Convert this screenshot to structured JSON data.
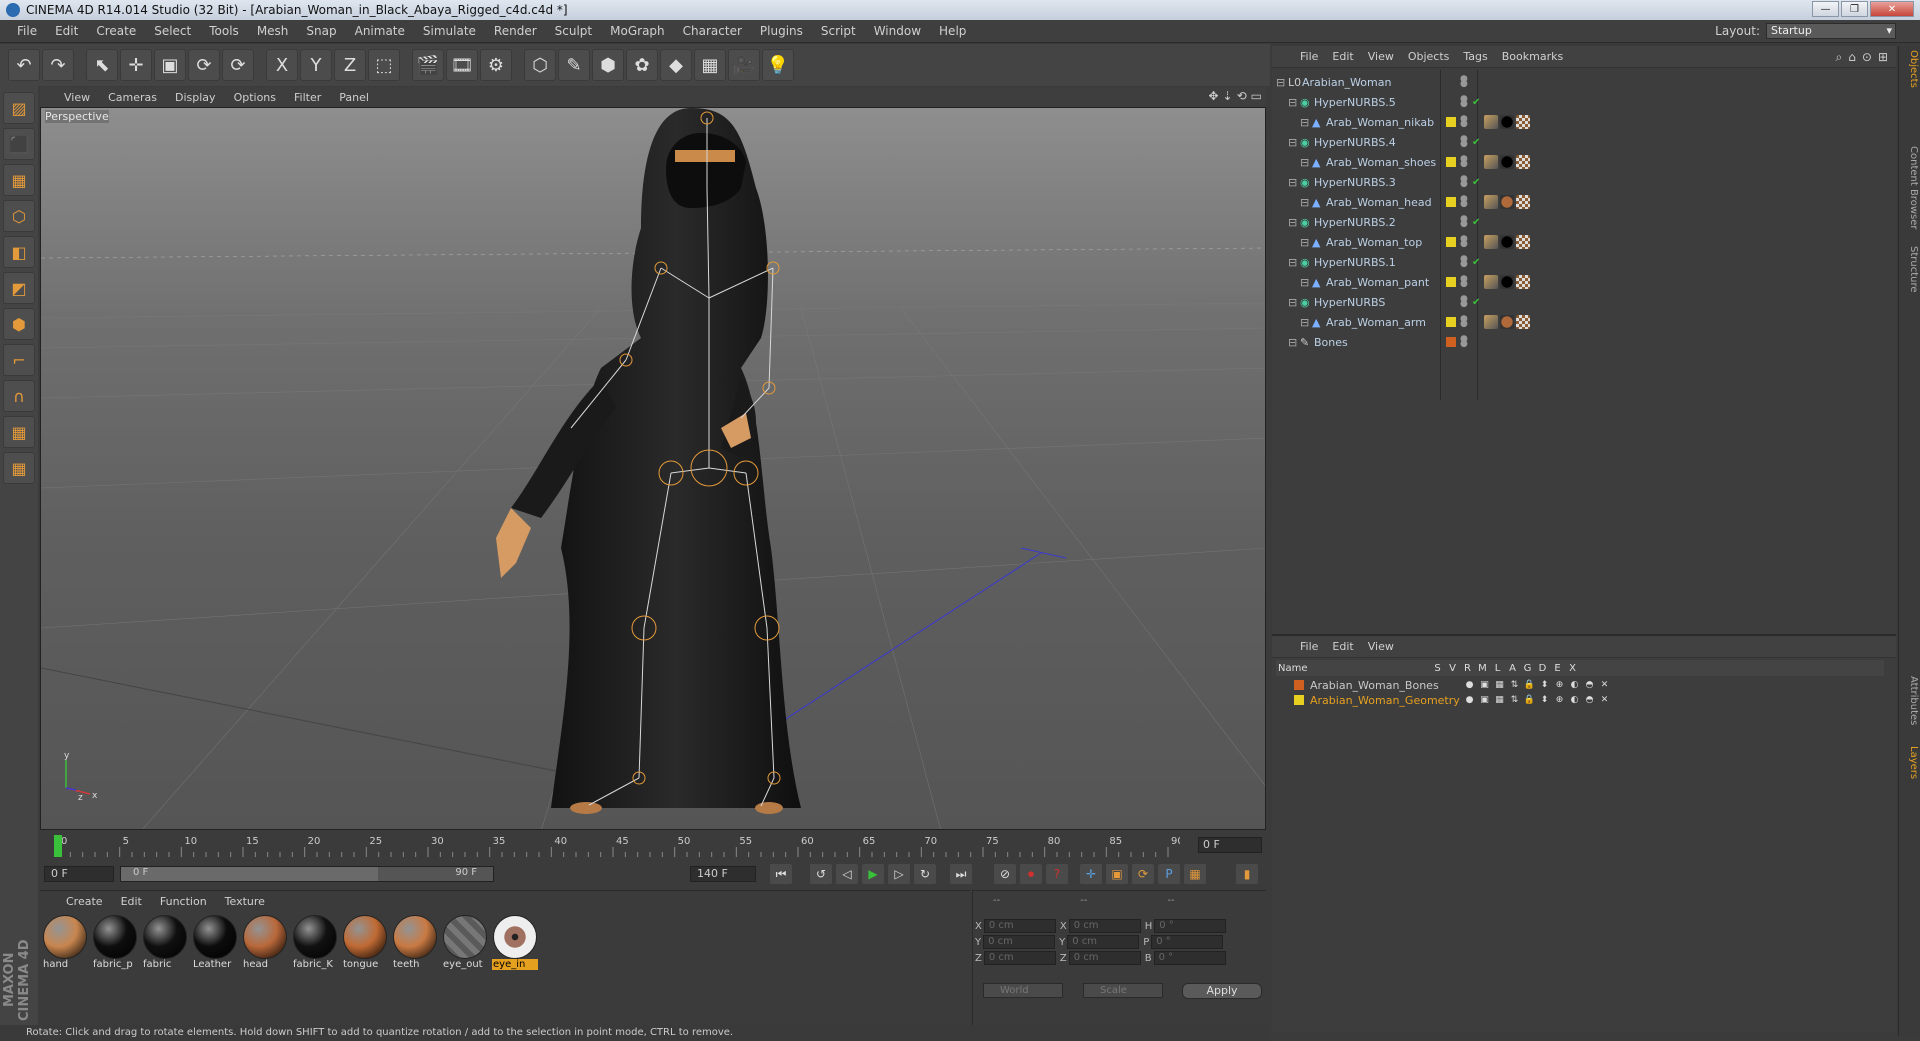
{
  "window": {
    "title": "CINEMA 4D R14.014 Studio (32 Bit) - [Arabian_Woman_in_Black_Abaya_Rigged_c4d.c4d *]",
    "buttons": [
      "—",
      "❐",
      "✕"
    ]
  },
  "menubar": [
    "File",
    "Edit",
    "Create",
    "Select",
    "Tools",
    "Mesh",
    "Snap",
    "Animate",
    "Simulate",
    "Render",
    "Sculpt",
    "MoGraph",
    "Character",
    "Plugins",
    "Script",
    "Window",
    "Help"
  ],
  "layout": {
    "label": "Layout:",
    "value": "Startup"
  },
  "toolbar": {
    "icons": [
      "undo-icon",
      "redo-icon",
      "live-selection-icon",
      "move-icon",
      "scale-icon",
      "rotate-icon",
      "recent-tool-icon",
      "x-axis-icon",
      "y-axis-icon",
      "z-axis-icon",
      "coordinate-system-icon",
      "render-view-icon",
      "render-picture-viewer-icon",
      "render-settings-icon",
      "cube-icon",
      "spline-pen-icon",
      "subdivision-surface-icon",
      "cloner-icon",
      "deformer-icon",
      "floor-icon",
      "camera-icon",
      "light-icon"
    ],
    "glyphs": [
      "↶",
      "↷",
      "⬉",
      "✛",
      "▣",
      "⟳",
      "⟳",
      "X",
      "Y",
      "Z",
      "⬚",
      "🎬",
      "🎞",
      "⚙",
      "⬡",
      "✎",
      "⬢",
      "✿",
      "◆",
      "▦",
      "🎥",
      "💡"
    ]
  },
  "lefttools": {
    "glyphs": [
      "▨",
      "⬛",
      "▦",
      "⬡",
      "◧",
      "◩",
      "⬢",
      "⌐",
      "∩",
      "▦",
      "▦"
    ]
  },
  "brand": "MAXON CINEMA 4D",
  "viewport_menu": [
    "View",
    "Cameras",
    "Display",
    "Options",
    "Filter",
    "Panel"
  ],
  "viewport_nav": [
    "✥",
    "⇣",
    "⟲",
    "▭"
  ],
  "viewport_label": "Perspective",
  "axis_labels": {
    "x": "x",
    "y": "y",
    "z": "z"
  },
  "timeline": {
    "ticks": [
      0,
      5,
      10,
      15,
      20,
      25,
      30,
      35,
      40,
      45,
      50,
      55,
      60,
      65,
      70,
      75,
      80,
      85,
      90
    ],
    "max_frame": 90,
    "current_frame": "0 F",
    "current_position": 0
  },
  "transport": {
    "start_field": "0 F",
    "range_start": "0 F",
    "range_end": "90 F",
    "end_field": "140 F",
    "range_fraction": 0.69
  },
  "materials": {
    "menu": [
      "Create",
      "Edit",
      "Function",
      "Texture"
    ],
    "items": [
      {
        "name": "hand",
        "color": "#c8864f",
        "selected": false
      },
      {
        "name": "fabric_p",
        "color": "#0e0e0e",
        "selected": false
      },
      {
        "name": "fabric",
        "color": "#101010",
        "selected": false
      },
      {
        "name": "Leather",
        "color": "#0c0c0c",
        "selected": false
      },
      {
        "name": "head",
        "color": "#b9683a",
        "selected": false
      },
      {
        "name": "fabric_K",
        "color": "#111111",
        "selected": false
      },
      {
        "name": "tongue",
        "color": "#c06a34",
        "selected": false
      },
      {
        "name": "teeth",
        "color": "#c97a43",
        "selected": false
      },
      {
        "name": "eye_out",
        "color": "#6a6a6a",
        "selected": false
      },
      {
        "name": "eye_in",
        "color": "#8a5a4a",
        "selected": true
      }
    ]
  },
  "coordinates": {
    "headers": [
      "--",
      "--",
      "--"
    ],
    "rows": [
      {
        "a": "X",
        "av": "0 cm",
        "b": "X",
        "bv": "0 cm",
        "c": "H",
        "cv": "0 °"
      },
      {
        "a": "Y",
        "av": "0 cm",
        "b": "Y",
        "bv": "0 cm",
        "c": "P",
        "cv": "0 °"
      },
      {
        "a": "Z",
        "av": "0 cm",
        "b": "Z",
        "bv": "0 cm",
        "c": "B",
        "cv": "0 °"
      }
    ],
    "mode1": "World",
    "mode2": "Scale",
    "apply": "Apply"
  },
  "status": "Rotate: Click and drag to rotate elements. Hold down SHIFT to add to quantize rotation / add to the selection in point mode, CTRL to remove.",
  "objects": {
    "menu": [
      "File",
      "Edit",
      "View",
      "Objects",
      "Tags",
      "Bookmarks"
    ],
    "tree": [
      {
        "name": "Arabian_Woman",
        "indent": 0,
        "icon": "L0",
        "layer": "",
        "check": false,
        "tags": []
      },
      {
        "name": "HyperNURBS.5",
        "indent": 1,
        "icon": "◉",
        "layer": "",
        "check": true,
        "tags": []
      },
      {
        "name": "Arab_Woman_nikab",
        "indent": 2,
        "icon": "▲",
        "layer": "#e8d020",
        "check": false,
        "tags": [
          "#c8a060",
          "#000000",
          "#d0d0d0"
        ]
      },
      {
        "name": "HyperNURBS.4",
        "indent": 1,
        "icon": "◉",
        "layer": "",
        "check": true,
        "tags": []
      },
      {
        "name": "Arab_Woman_shoes",
        "indent": 2,
        "icon": "▲",
        "layer": "#e8d020",
        "check": false,
        "tags": [
          "#c8a060",
          "#000000",
          "#d0d0d0"
        ]
      },
      {
        "name": "HyperNURBS.3",
        "indent": 1,
        "icon": "◉",
        "layer": "",
        "check": true,
        "tags": []
      },
      {
        "name": "Arab_Woman_head",
        "indent": 2,
        "icon": "▲",
        "layer": "#e8d020",
        "check": false,
        "tags": [
          "#c8a060",
          "#b06a3a",
          "#d0d0d0"
        ]
      },
      {
        "name": "HyperNURBS.2",
        "indent": 1,
        "icon": "◉",
        "layer": "",
        "check": true,
        "tags": []
      },
      {
        "name": "Arab_Woman_top",
        "indent": 2,
        "icon": "▲",
        "layer": "#e8d020",
        "check": false,
        "tags": [
          "#c8a060",
          "#000000",
          "#d0d0d0"
        ]
      },
      {
        "name": "HyperNURBS.1",
        "indent": 1,
        "icon": "◉",
        "layer": "",
        "check": true,
        "tags": []
      },
      {
        "name": "Arab_Woman_pant",
        "indent": 2,
        "icon": "▲",
        "layer": "#e8d020",
        "check": false,
        "tags": [
          "#c8a060",
          "#000000",
          "#d0d0d0"
        ]
      },
      {
        "name": "HyperNURBS",
        "indent": 1,
        "icon": "◉",
        "layer": "",
        "check": true,
        "tags": []
      },
      {
        "name": "Arab_Woman_arm",
        "indent": 2,
        "icon": "▲",
        "layer": "#e8d020",
        "check": false,
        "tags": [
          "#c8a060",
          "#b06a3a",
          "#d0d0d0"
        ]
      },
      {
        "name": "Bones",
        "indent": 1,
        "icon": "✎",
        "layer": "#d06020",
        "check": false,
        "tags": []
      }
    ]
  },
  "layers": {
    "menu": [
      "File",
      "Edit",
      "View"
    ],
    "columns": [
      "Name",
      "S",
      "V",
      "R",
      "M",
      "L",
      "A",
      "G",
      "D",
      "E",
      "X"
    ],
    "rows": [
      {
        "name": "Arabian_Woman_Bones",
        "color": "#d06020",
        "text_color": "#c8c8c8"
      },
      {
        "name": "Arabian_Woman_Geometry",
        "color": "#e8d020",
        "text_color": "#e6a020"
      }
    ]
  },
  "sidetabs": [
    "Objects",
    "Content Browser",
    "Structure",
    "Attributes",
    "Layers"
  ]
}
